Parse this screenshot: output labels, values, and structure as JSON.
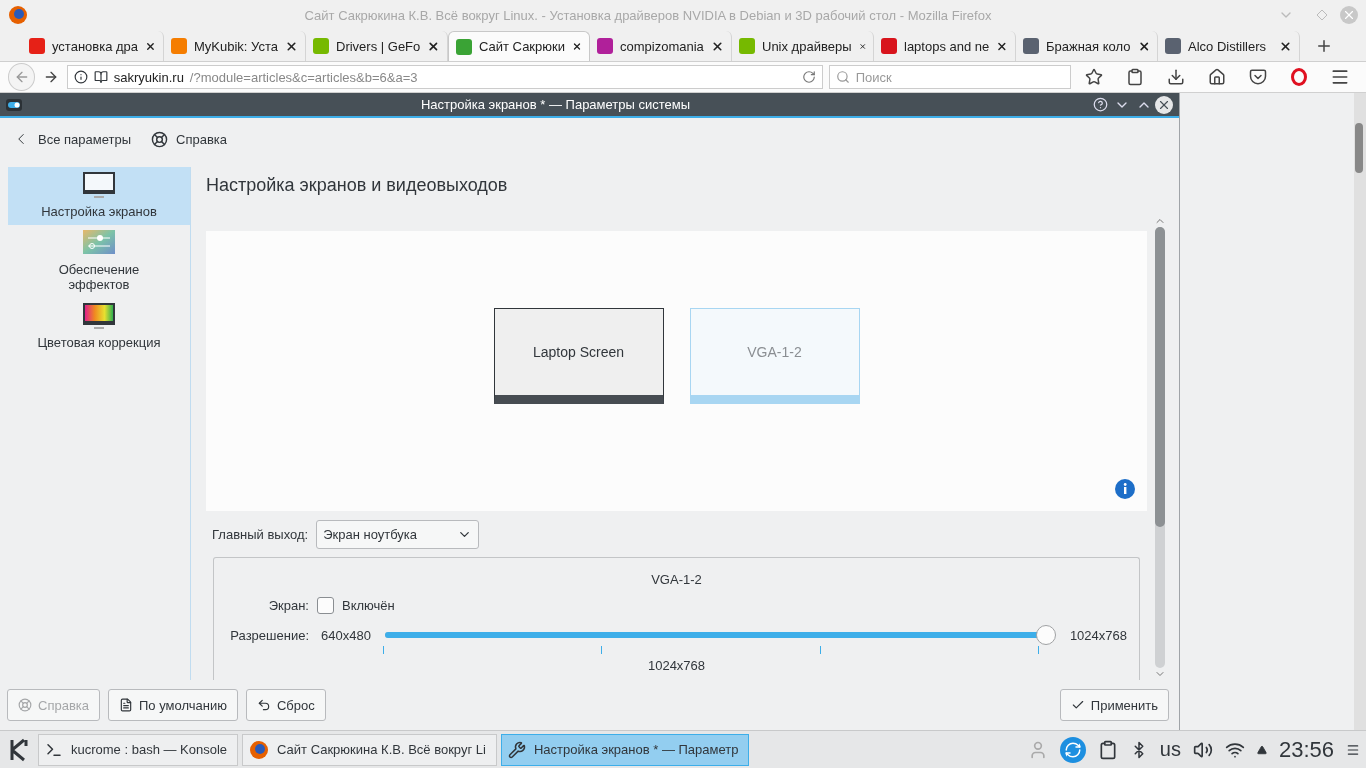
{
  "browser": {
    "title": "Сайт Сакрюкина К.В. Всё вокруг Linux. - Установка драйверов NVIDIA в Debian и 3D рабочий стол - Mozilla Firefox",
    "tabs": [
      {
        "label": "установка дра",
        "selected": false,
        "color": "#e62117"
      },
      {
        "label": "MyKubik: Уста",
        "selected": false,
        "color": "#f57d00"
      },
      {
        "label": "Drivers | GeFo",
        "selected": false,
        "color": "#76b900"
      },
      {
        "label": "Сайт Сакрюки",
        "selected": true,
        "color": "#3aa335"
      },
      {
        "label": "compizomania",
        "selected": false,
        "color": "#b0209a"
      },
      {
        "label": "Unix драйверы",
        "selected": false,
        "color": "#76b900"
      },
      {
        "label": "laptops and ne",
        "selected": false,
        "color": "#d8141c"
      },
      {
        "label": "Бражная коло",
        "selected": false,
        "color": "#5a6270"
      },
      {
        "label": "Alco Distillers",
        "selected": false,
        "color": "#5a6270"
      }
    ],
    "url_host": "sakryukin.ru",
    "url_path": "/?module=articles&c=articles&b=6&a=3",
    "search_placeholder": "Поиск"
  },
  "dialog": {
    "title": "Настройка экранов * — Параметры системы",
    "back": "Все параметры",
    "help": "Справка",
    "sidebar": [
      {
        "label": "Настройка экранов",
        "selected": true,
        "kind": "monitor"
      },
      {
        "label": "Обеспечение эффектов",
        "selected": false,
        "kind": "effects"
      },
      {
        "label": "Цветовая коррекция",
        "selected": false,
        "kind": "color"
      }
    ],
    "heading": "Настройка экранов и видеовыходов",
    "screens": [
      {
        "label": "Laptop Screen",
        "enabled": true
      },
      {
        "label": "VGA-1-2",
        "enabled": false
      }
    ],
    "primary_label": "Главный выход:",
    "primary_value": "Экран ноутбука",
    "output": {
      "name": "VGA-1-2",
      "screen_label": "Экран:",
      "enabled_label": "Включён",
      "checked": false,
      "resolution_label": "Разрешение:",
      "min": "640x480",
      "max": "1024x768",
      "level": 1,
      "current": "1024x768"
    },
    "buttons": [
      {
        "label": "Справка",
        "kind": "help",
        "disabled": true
      },
      {
        "label": "По умолчанию",
        "kind": "defaults",
        "disabled": false
      },
      {
        "label": "Сброс",
        "kind": "reset",
        "disabled": false
      },
      {
        "label": "Применить",
        "kind": "apply",
        "disabled": false
      }
    ]
  },
  "taskbar": {
    "tasks": [
      {
        "label": "kucrome : bash — Konsole",
        "selected": false,
        "kind": "terminal"
      },
      {
        "label": "Сайт Сакрюкина К.В. Всё вокруг Li",
        "selected": false,
        "kind": "browser"
      },
      {
        "label": "Настройка экранов * — Параметр",
        "selected": true,
        "kind": "tools"
      }
    ],
    "layout": "us",
    "clock": "23:56"
  }
}
